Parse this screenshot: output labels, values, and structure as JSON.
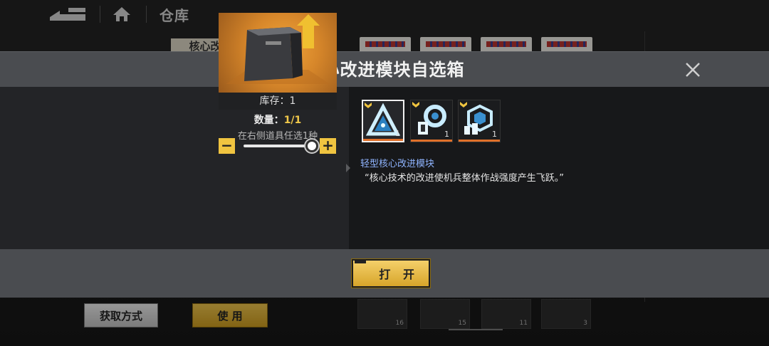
{
  "background": {
    "title": "仓库",
    "tab_label": "核心改进模块自选箱",
    "buttons": {
      "acquire": "获取方式",
      "use": "使 用"
    },
    "items": [
      {
        "count": "16"
      },
      {
        "count": "15"
      },
      {
        "count": "11"
      },
      {
        "count": "3"
      }
    ]
  },
  "modal": {
    "title": "核心改进模块自选箱",
    "stock": "库存：1",
    "quantity_label": "数量：",
    "quantity_value": "1/1",
    "hint": "在右侧道具任选1种",
    "minus": "−",
    "plus": "+",
    "slider_level": 1.0,
    "options": [
      {
        "icon": "light-core-module-icon",
        "count": "1",
        "selected": true
      },
      {
        "icon": "medium-core-module-icon",
        "count": "1",
        "selected": false
      },
      {
        "icon": "heavy-core-module-icon",
        "count": "1",
        "selected": false
      }
    ],
    "selected_name": "轻型核心改进模块",
    "selected_desc": "“核心技术的改进使机兵整体作战强度产生飞跃。”",
    "open_button": "打 开"
  },
  "colors": {
    "accent_gold": "#f0c440",
    "name_blue": "#8fb4ff",
    "header_gray": "#4a4c50",
    "rarity_orange": "#e0702a"
  }
}
